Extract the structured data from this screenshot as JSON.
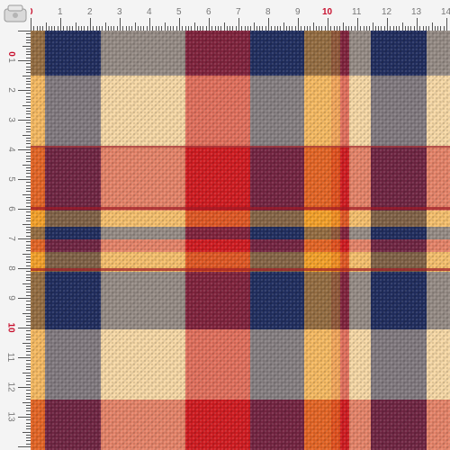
{
  "image": {
    "subject": "plaid-flannel-fabric-swatch",
    "colors": {
      "cream": "#f5d8a6",
      "navy": "#233061",
      "red": "#d01d22",
      "bright_red": "#e6353a",
      "dark_red": "#9c1824",
      "gold": "#f4a32c",
      "orange": "#ef7d1f",
      "grey": "#6f6f72"
    }
  },
  "ruler": {
    "unit": "cm",
    "top_labels": [
      "0",
      "1",
      "2",
      "3",
      "4",
      "5",
      "6",
      "7",
      "8",
      "9",
      "10",
      "11",
      "12",
      "13",
      "14"
    ],
    "left_labels": [
      "0",
      "1",
      "2",
      "3",
      "4",
      "5",
      "6",
      "7",
      "8",
      "9",
      "10",
      "11",
      "12",
      "13"
    ],
    "accent_labels": [
      "0",
      "10"
    ],
    "accent_color": "#c8102e"
  }
}
